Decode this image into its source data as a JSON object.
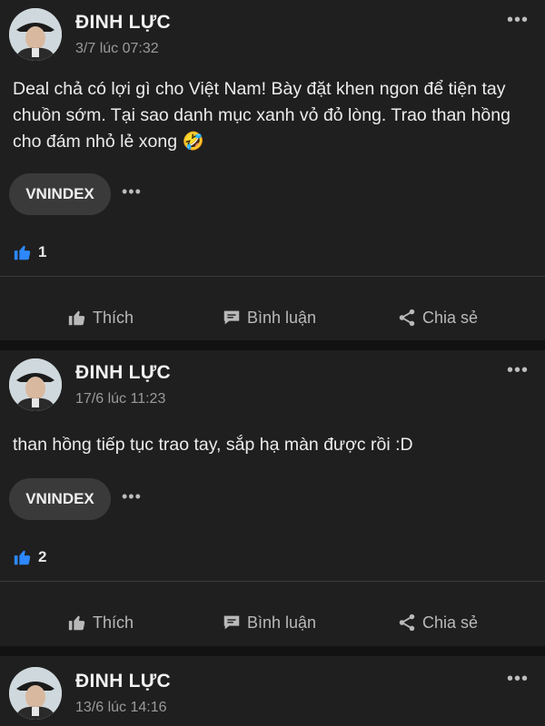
{
  "posts": [
    {
      "author": "ĐINH LỰC",
      "time": "3/7 lúc 07:32",
      "content": "Deal chả có lợi gì cho Việt Nam! Bày đặt khen ngon để tiện tay chuồn sớm. Tại sao danh mục xanh vỏ đỏ lòng. Trao than hồng cho đám nhỏ lẻ xong 🤣",
      "tag": "VNINDEX",
      "likes": "1"
    },
    {
      "author": "ĐINH LỰC",
      "time": "17/6 lúc 11:23",
      "content": "than hồng tiếp tục trao tay, sắp hạ màn được rồi :D",
      "tag": "VNINDEX",
      "likes": "2"
    },
    {
      "author": "ĐINH LỰC",
      "time": "13/6 lúc 14:16"
    }
  ],
  "actions": {
    "like": "Thích",
    "comment": "Bình luận",
    "share": "Chia sẻ"
  },
  "more_glyph": "•••",
  "colors": {
    "background": "#121212",
    "card": "#1f1f1f",
    "like_icon": "#2d88ff",
    "muted": "#9a9a9a"
  },
  "icons": [
    "thumbs-up-icon",
    "comment-icon",
    "share-icon",
    "more-icon"
  ]
}
